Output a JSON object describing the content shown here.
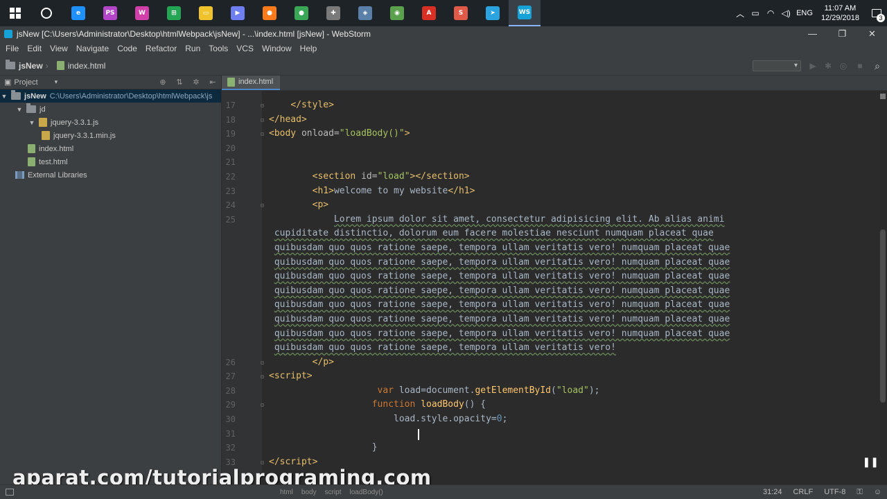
{
  "taskbar": {
    "apps": [
      {
        "name": "edge-icon",
        "glyph": "e",
        "color": "#1e90ff"
      },
      {
        "name": "phpstorm-icon",
        "glyph": "PS",
        "color": "#b345c9"
      },
      {
        "name": "webstorm-icon-alt",
        "glyph": "W",
        "color": "#d13fa8"
      },
      {
        "name": "store-icon",
        "glyph": "⊞",
        "color": "#23a554"
      },
      {
        "name": "file-explorer-icon",
        "glyph": "▭",
        "color": "#f0c22b"
      },
      {
        "name": "media-player-icon",
        "glyph": "▶",
        "color": "#6f7ef0"
      },
      {
        "name": "firefox-icon",
        "glyph": "●",
        "color": "#ff7a1a"
      },
      {
        "name": "chrome-icon",
        "glyph": "●",
        "color": "#3aa757"
      },
      {
        "name": "tools-icon",
        "glyph": "✚",
        "color": "#7a7a7a"
      },
      {
        "name": "3d-box-icon",
        "glyph": "◈",
        "color": "#5a7fa8"
      },
      {
        "name": "globe-icon",
        "glyph": "◉",
        "color": "#5aa04d"
      },
      {
        "name": "pdf-icon",
        "glyph": "A",
        "color": "#d93025"
      },
      {
        "name": "presentation-icon",
        "glyph": "S",
        "color": "#e05a47"
      },
      {
        "name": "telegram-icon",
        "glyph": "➤",
        "color": "#2aa3de"
      },
      {
        "name": "webstorm-icon",
        "glyph": "WS",
        "color": "#17a2d7"
      }
    ],
    "tray": {
      "language": "ENG",
      "time": "11:07 AM",
      "date": "12/29/2018",
      "notifications": "3"
    }
  },
  "window": {
    "title": "jsNew [C:\\Users\\Administrator\\Desktop\\htmlWebpack\\jsNew] - ...\\index.html [jsNew] - WebStorm",
    "controls": {
      "minimize": "—",
      "maximize": "❐",
      "close": "✕"
    }
  },
  "menu": [
    "File",
    "Edit",
    "View",
    "Navigate",
    "Code",
    "Refactor",
    "Run",
    "Tools",
    "VCS",
    "Window",
    "Help"
  ],
  "nav": {
    "project": "jsNew",
    "file": "index.html"
  },
  "project_panel": {
    "title": "Project",
    "root": {
      "name": "jsNew",
      "path": "C:\\Users\\Administrator\\Desktop\\htmlWebpack\\js"
    },
    "items": [
      {
        "label": "jd",
        "type": "folder",
        "depth": 1
      },
      {
        "label": "jquery-3.3.1.js",
        "type": "js",
        "depth": 2
      },
      {
        "label": "jquery-3.3.1.min.js",
        "type": "js",
        "depth": 3
      },
      {
        "label": "index.html",
        "type": "html",
        "depth": 1
      },
      {
        "label": "test.html",
        "type": "html",
        "depth": 1
      }
    ],
    "external": "External Libraries"
  },
  "editor": {
    "tab": "index.html",
    "lines": [
      {
        "n": "17",
        "html": "    <span class=\"tg\">&lt;/style&gt;</span>",
        "fold": "⊟"
      },
      {
        "n": "18",
        "html": "<span class=\"tg\">&lt;/head&gt;</span>",
        "fold": "⊟"
      },
      {
        "n": "19",
        "html": "<span class=\"tg\">&lt;body</span> <span class=\"at\">onload=</span><span class=\"st\">\"loadBody()\"</span><span class=\"tg\">&gt;</span>",
        "fold": "⊟"
      },
      {
        "n": "20",
        "html": "",
        "fold": ""
      },
      {
        "n": "21",
        "html": "",
        "fold": ""
      },
      {
        "n": "22",
        "html": "        <span class=\"tg\">&lt;section</span> <span class=\"at\">id=</span><span class=\"st\">\"load\"</span><span class=\"tg\">&gt;&lt;/section&gt;</span>",
        "fold": ""
      },
      {
        "n": "23",
        "html": "        <span class=\"tg\">&lt;h1&gt;</span><span class=\"tx\">welcome to my website</span><span class=\"tg\">&lt;/h1&gt;</span>",
        "fold": ""
      },
      {
        "n": "24",
        "html": "        <span class=\"tg\">&lt;p&gt;</span>",
        "fold": "⊟"
      },
      {
        "n": "25",
        "html": "            <span class=\"wavy\">Lorem ipsum dolor sit amet, consectetur adipisicing elit. Ab alias animi</span>",
        "fold": ""
      },
      {
        "n": "",
        "html": " <span class=\"wavy\">cupiditate distinctio, dolorum eum facere molestiae nesciunt numquam placeat quae</span>",
        "fold": ""
      },
      {
        "n": "",
        "html": " <span class=\"wavy\">quibusdam quo quos ratione saepe, tempora ullam veritatis vero! numquam placeat quae</span>",
        "fold": ""
      },
      {
        "n": "",
        "html": " <span class=\"wavy\">quibusdam quo quos ratione saepe, tempora ullam veritatis vero! numquam placeat quae</span>",
        "fold": ""
      },
      {
        "n": "",
        "html": " <span class=\"wavy\">quibusdam quo quos ratione saepe, tempora ullam veritatis vero! numquam placeat quae</span>",
        "fold": ""
      },
      {
        "n": "",
        "html": " <span class=\"wavy\">quibusdam quo quos ratione saepe, tempora ullam veritatis vero! numquam placeat quae</span>",
        "fold": ""
      },
      {
        "n": "",
        "html": " <span class=\"wavy\">quibusdam quo quos ratione saepe, tempora ullam veritatis vero! numquam placeat quae</span>",
        "fold": ""
      },
      {
        "n": "",
        "html": " <span class=\"wavy\">quibusdam quo quos ratione saepe, tempora ullam veritatis vero! numquam placeat quae</span>",
        "fold": ""
      },
      {
        "n": "",
        "html": " <span class=\"wavy\">quibusdam quo quos ratione saepe, tempora ullam veritatis vero! numquam placeat quae</span>",
        "fold": ""
      },
      {
        "n": "",
        "html": " <span class=\"wavy\">quibusdam quo quos ratione saepe, tempora ullam veritatis vero!</span>",
        "fold": ""
      },
      {
        "n": "26",
        "html": "        <span class=\"tg\">&lt;/p&gt;</span>",
        "fold": "⊟"
      },
      {
        "n": "27",
        "html": "<span class=\"tg\">&lt;script&gt;</span>",
        "fold": "⊟"
      },
      {
        "n": "28",
        "html": "                    <span class=\"kw\">var</span> <span class=\"tx\">load=document.</span><span class=\"fn\">getElementById</span><span class=\"tx\">(</span><span class=\"st\">\"load\"</span><span class=\"tx\">);</span>",
        "fold": ""
      },
      {
        "n": "29",
        "html": "                   <span class=\"kw\">function</span> <span class=\"fn\">loadBody</span><span class=\"tx\">() {</span>",
        "fold": "⊟"
      },
      {
        "n": "30",
        "html": "                       <span class=\"tx\">load.style.opacity=</span><span class=\"num\">0</span><span class=\"tx\">;</span>",
        "fold": ""
      },
      {
        "n": "31",
        "html": "",
        "fold": "",
        "caret": true
      },
      {
        "n": "32",
        "html": "                   <span class=\"tx\">}</span>",
        "fold": ""
      },
      {
        "n": "33",
        "html": "<span class=\"tg\">&lt;/script&gt;</span>",
        "fold": "⊟"
      }
    ]
  },
  "status": {
    "breadcrumb": [
      "html",
      "body",
      "script",
      "loadBody()"
    ],
    "position": "31:24",
    "line_ending": "CRLF",
    "encoding": "UTF-8"
  },
  "watermark": "aparat.com/tutorialprograming.com"
}
